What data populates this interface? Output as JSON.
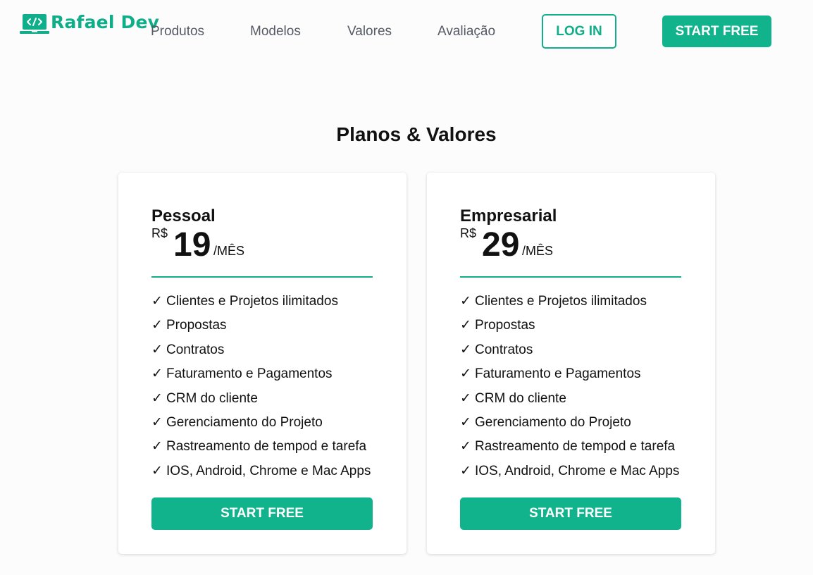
{
  "header": {
    "logo_text": "Rafael Dev",
    "nav": [
      "Produtos",
      "Modelos",
      "Valores",
      "Avaliação"
    ],
    "login_label": "LOG IN",
    "start_label": "START FREE"
  },
  "main": {
    "title": "Planos & Valores",
    "plans": [
      {
        "name": "Pessoal",
        "currency": "R$",
        "amount": "19",
        "period": "/MÊS",
        "features": [
          "Clientes e Projetos ilimitados",
          "Propostas",
          "Contratos",
          "Faturamento e Pagamentos",
          "CRM do cliente",
          "Gerenciamento do Projeto",
          "Rastreamento de tempod e tarefa",
          "IOS, Android, Chrome e Mac Apps"
        ],
        "button": "START FREE"
      },
      {
        "name": "Empresarial",
        "currency": "R$",
        "amount": "29",
        "period": "/MÊS",
        "features": [
          "Clientes e Projetos ilimitados",
          "Propostas",
          "Contratos",
          "Faturamento e Pagamentos",
          "CRM do cliente",
          "Gerenciamento do Projeto",
          "Rastreamento de tempod e tarefa",
          "IOS, Android, Chrome e Mac Apps"
        ],
        "button": "START FREE"
      }
    ]
  },
  "icons": {
    "logo": "laptop-code-icon",
    "feature_bullet": "checkmark-icon"
  },
  "colors": {
    "accent": "#10b38c",
    "text": "#111111",
    "nav_text": "#555b66",
    "background": "#fcfcfc"
  }
}
